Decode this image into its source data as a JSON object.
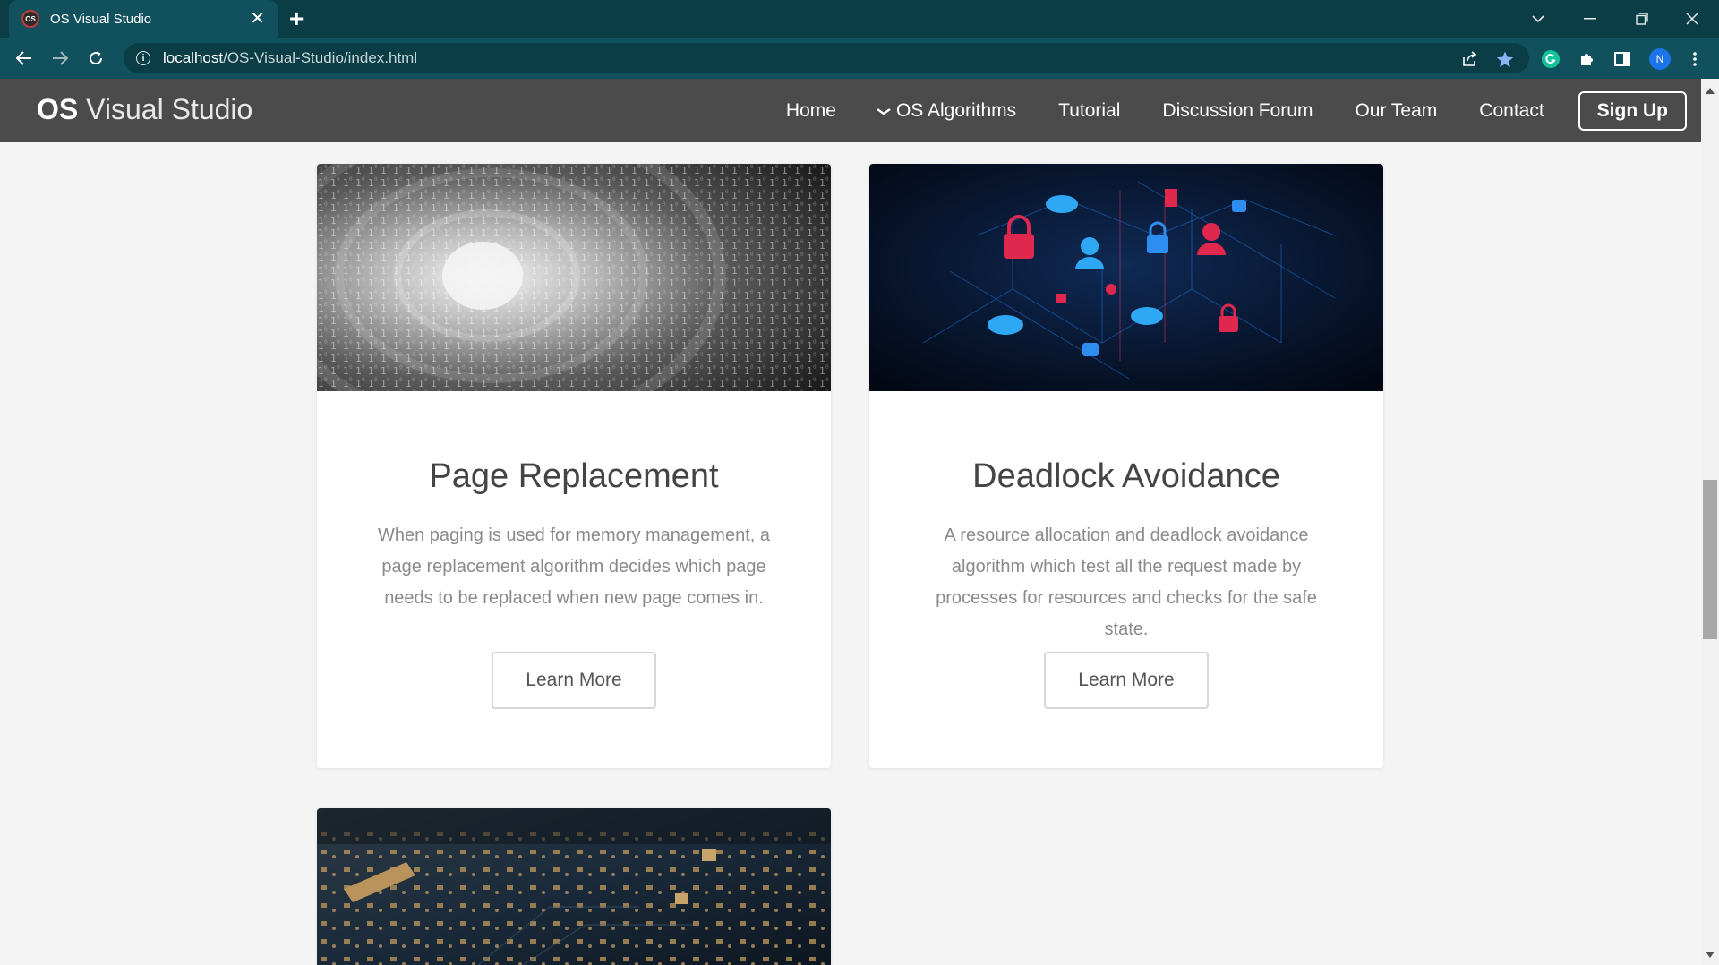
{
  "browser": {
    "tab_title": "OS Visual Studio",
    "favicon_text": "OS",
    "url_host": "localhost",
    "url_path": "/OS-Visual-Studio/index.html",
    "profile_initial": "N"
  },
  "site": {
    "brand_bold": "OS",
    "brand_rest": "Visual Studio",
    "nav": {
      "home": "Home",
      "algorithms": "OS Algorithms",
      "tutorial": "Tutorial",
      "forum": "Discussion Forum",
      "team": "Our Team",
      "contact": "Contact",
      "signup": "Sign Up"
    }
  },
  "cards": [
    {
      "title": "Page Replacement",
      "text": "When paging is used for memory management, a page replacement algorithm decides which page needs to be replaced when new page comes in.",
      "button": "Learn More"
    },
    {
      "title": "Deadlock Avoidance",
      "text": "A resource allocation and deadlock avoidance algorithm which test all the request made by processes for resources and checks for the safe state.",
      "button": "Learn More"
    }
  ],
  "colors": {
    "tabstrip": "#0b3d47",
    "toolbar": "#11505d",
    "navbar": "#4b4b4b",
    "page_bg": "#f4f4f4",
    "grammarly": "#15c39a",
    "profile": "#1a73e8"
  },
  "icons": {
    "back": "back-arrow-icon",
    "forward": "forward-arrow-icon",
    "reload": "reload-icon",
    "info": "info-icon",
    "share": "share-icon",
    "bookmark": "star-icon",
    "extensions": "puzzle-icon",
    "sidepanel": "side-panel-icon",
    "menu": "kebab-menu-icon",
    "dropdown": "chevron-down-icon"
  }
}
